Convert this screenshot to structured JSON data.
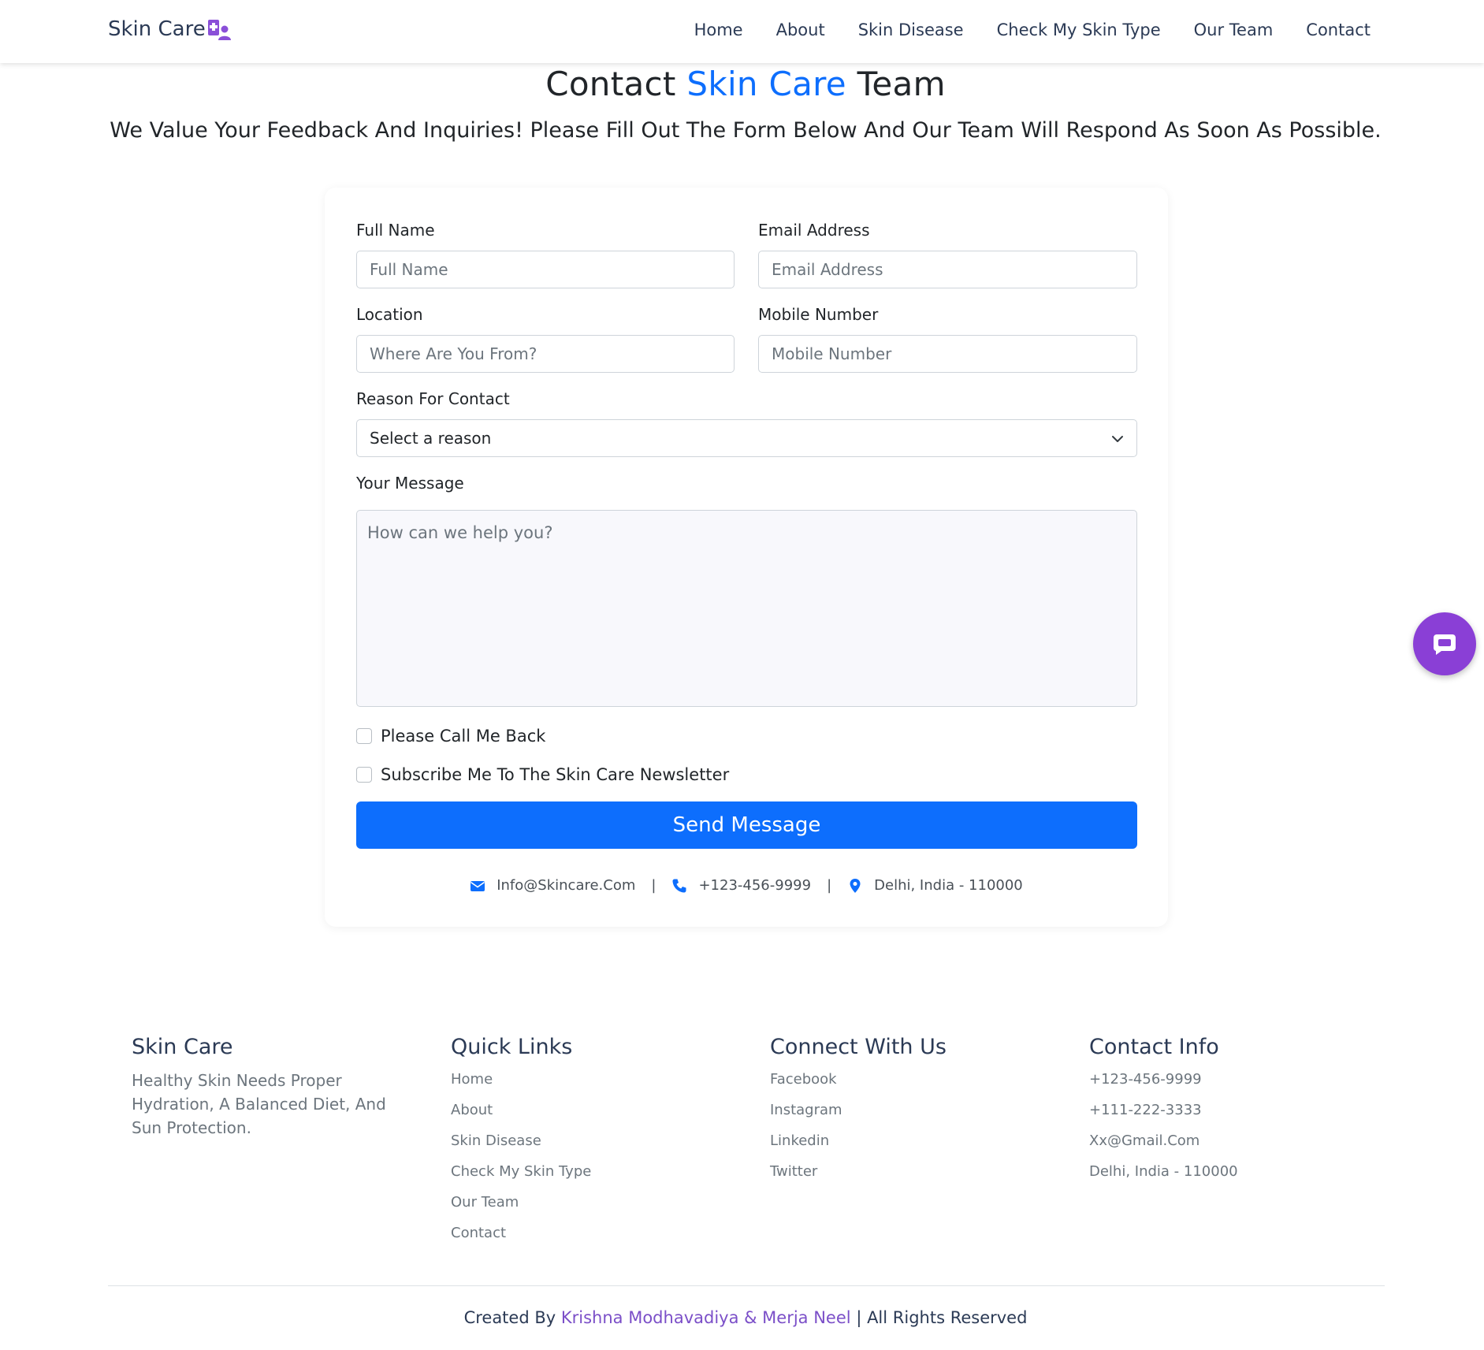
{
  "brand": {
    "name": "Skin Care",
    "icon": "doctor-user-icon",
    "icon_color": "#8a4fd8"
  },
  "nav": {
    "items": [
      {
        "label": "Home"
      },
      {
        "label": "About"
      },
      {
        "label": "Skin Disease"
      },
      {
        "label": "Check My Skin Type"
      },
      {
        "label": "Our Team"
      },
      {
        "label": "Contact"
      }
    ]
  },
  "hero": {
    "title_prefix": "Contact",
    "title_accent": "Skin Care",
    "title_suffix": "Team",
    "subtitle": "We Value Your Feedback And Inquiries! Please Fill Out The Form Below And Our Team Will Respond As Soon As Possible."
  },
  "form": {
    "full_name": {
      "label": "Full Name",
      "placeholder": "Full Name",
      "value": ""
    },
    "email": {
      "label": "Email Address",
      "placeholder": "Email Address",
      "value": ""
    },
    "location": {
      "label": "Location",
      "placeholder": "Where Are You From?",
      "value": ""
    },
    "mobile": {
      "label": "Mobile Number",
      "placeholder": "Mobile Number",
      "value": ""
    },
    "reason": {
      "label": "Reason For Contact",
      "selected": "Select a reason"
    },
    "message": {
      "label": "Your Message",
      "placeholder": "How can we help you?",
      "value": ""
    },
    "call_back": {
      "label": "Please Call Me Back",
      "checked": false
    },
    "newsletter": {
      "label": "Subscribe Me To The Skin Care Newsletter",
      "checked": false
    },
    "submit_label": "Send Message"
  },
  "contact_strip": {
    "email": "Info@Skincare.Com",
    "phone": "+123-456-9999",
    "address": "Delhi, India - 110000",
    "separator": "|",
    "icon_color": "#0d6efd"
  },
  "chat_button": {
    "icon": "chat-bubble-icon",
    "color": "#8a3fd6"
  },
  "footer": {
    "about": {
      "heading": "Skin Care",
      "text": "Healthy Skin Needs Proper Hydration, A Balanced Diet, And Sun Protection."
    },
    "quick_links": {
      "heading": "Quick Links",
      "items": [
        "Home",
        "About",
        "Skin Disease",
        "Check My Skin Type",
        "Our Team",
        "Contact"
      ]
    },
    "connect": {
      "heading": "Connect With Us",
      "items": [
        "Facebook",
        "Instagram",
        "Linkedin",
        "Twitter"
      ]
    },
    "contact_info": {
      "heading": "Contact Info",
      "items": [
        "+123-456-9999",
        "+111-222-3333",
        "Xx@Gmail.Com",
        "Delhi, India - 110000"
      ]
    },
    "credits": {
      "prefix": "Created By",
      "authors": "Krishna Modhavadiya & Merja Neel",
      "suffix": "| All Rights Reserved"
    }
  },
  "colors": {
    "primary": "#0d6efd",
    "accent_purple": "#8a3fd6",
    "heading_dark": "#2b3a55",
    "muted": "#6c757d"
  }
}
